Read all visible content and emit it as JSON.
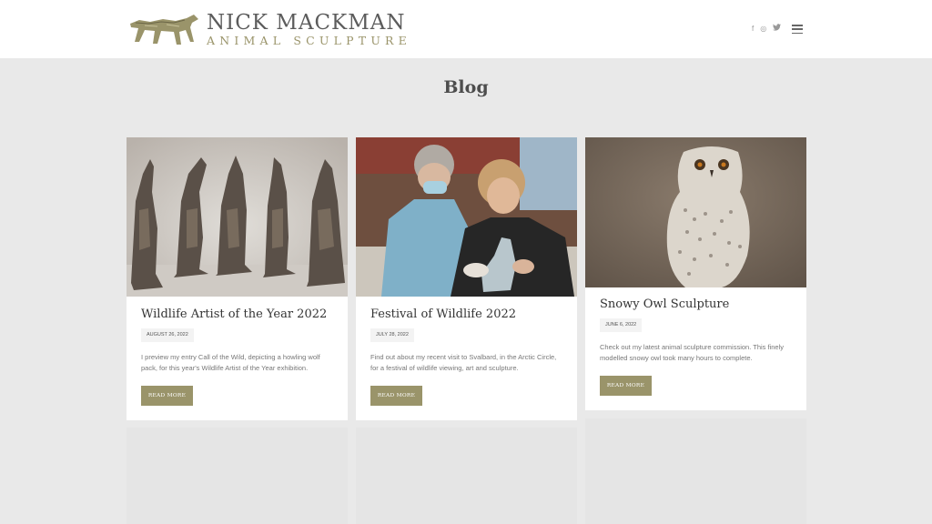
{
  "header": {
    "logo_name": "NICK MACKMAN",
    "logo_subtitle": "ANIMAL SCULPTURE",
    "logo_icon": "wolf-sculpture-logo",
    "social": [
      {
        "icon": "facebook-icon",
        "glyph": "f"
      },
      {
        "icon": "instagram-icon",
        "glyph": "◎"
      },
      {
        "icon": "twitter-icon",
        "glyph": "🐦"
      }
    ],
    "menu_icon": "hamburger-menu-icon"
  },
  "page": {
    "title": "Blog"
  },
  "posts": [
    {
      "title": "Wildlife Artist of the Year 2022",
      "date": "AUGUST 26, 2022",
      "excerpt": "I preview my entry Call of the Wild, depicting a howling wolf pack, for this year's Wildlife Artist of the Year exhibition.",
      "button": "READ MORE",
      "image": "wolf-sculptures-image"
    },
    {
      "title": "Festival of Wildlife 2022",
      "date": "JULY 28, 2022",
      "excerpt": "Find out about my recent visit to Svalbard, in the Arctic Circle, for a festival of wildlife viewing, art and sculpture.",
      "button": "READ MORE",
      "image": "festival-sculpting-image"
    },
    {
      "title": "Snowy Owl Sculpture",
      "date": "JUNE 6, 2022",
      "excerpt": "Check out my latest animal sculpture commission. This finely modelled snowy owl took many hours to complete.",
      "button": "READ MORE",
      "image": "snowy-owl-image"
    }
  ],
  "colors": {
    "accent": "#9a946a",
    "page_background": "#e9e9e9",
    "card_background": "#ffffff",
    "heading_text": "#333333",
    "body_text": "#777777"
  }
}
